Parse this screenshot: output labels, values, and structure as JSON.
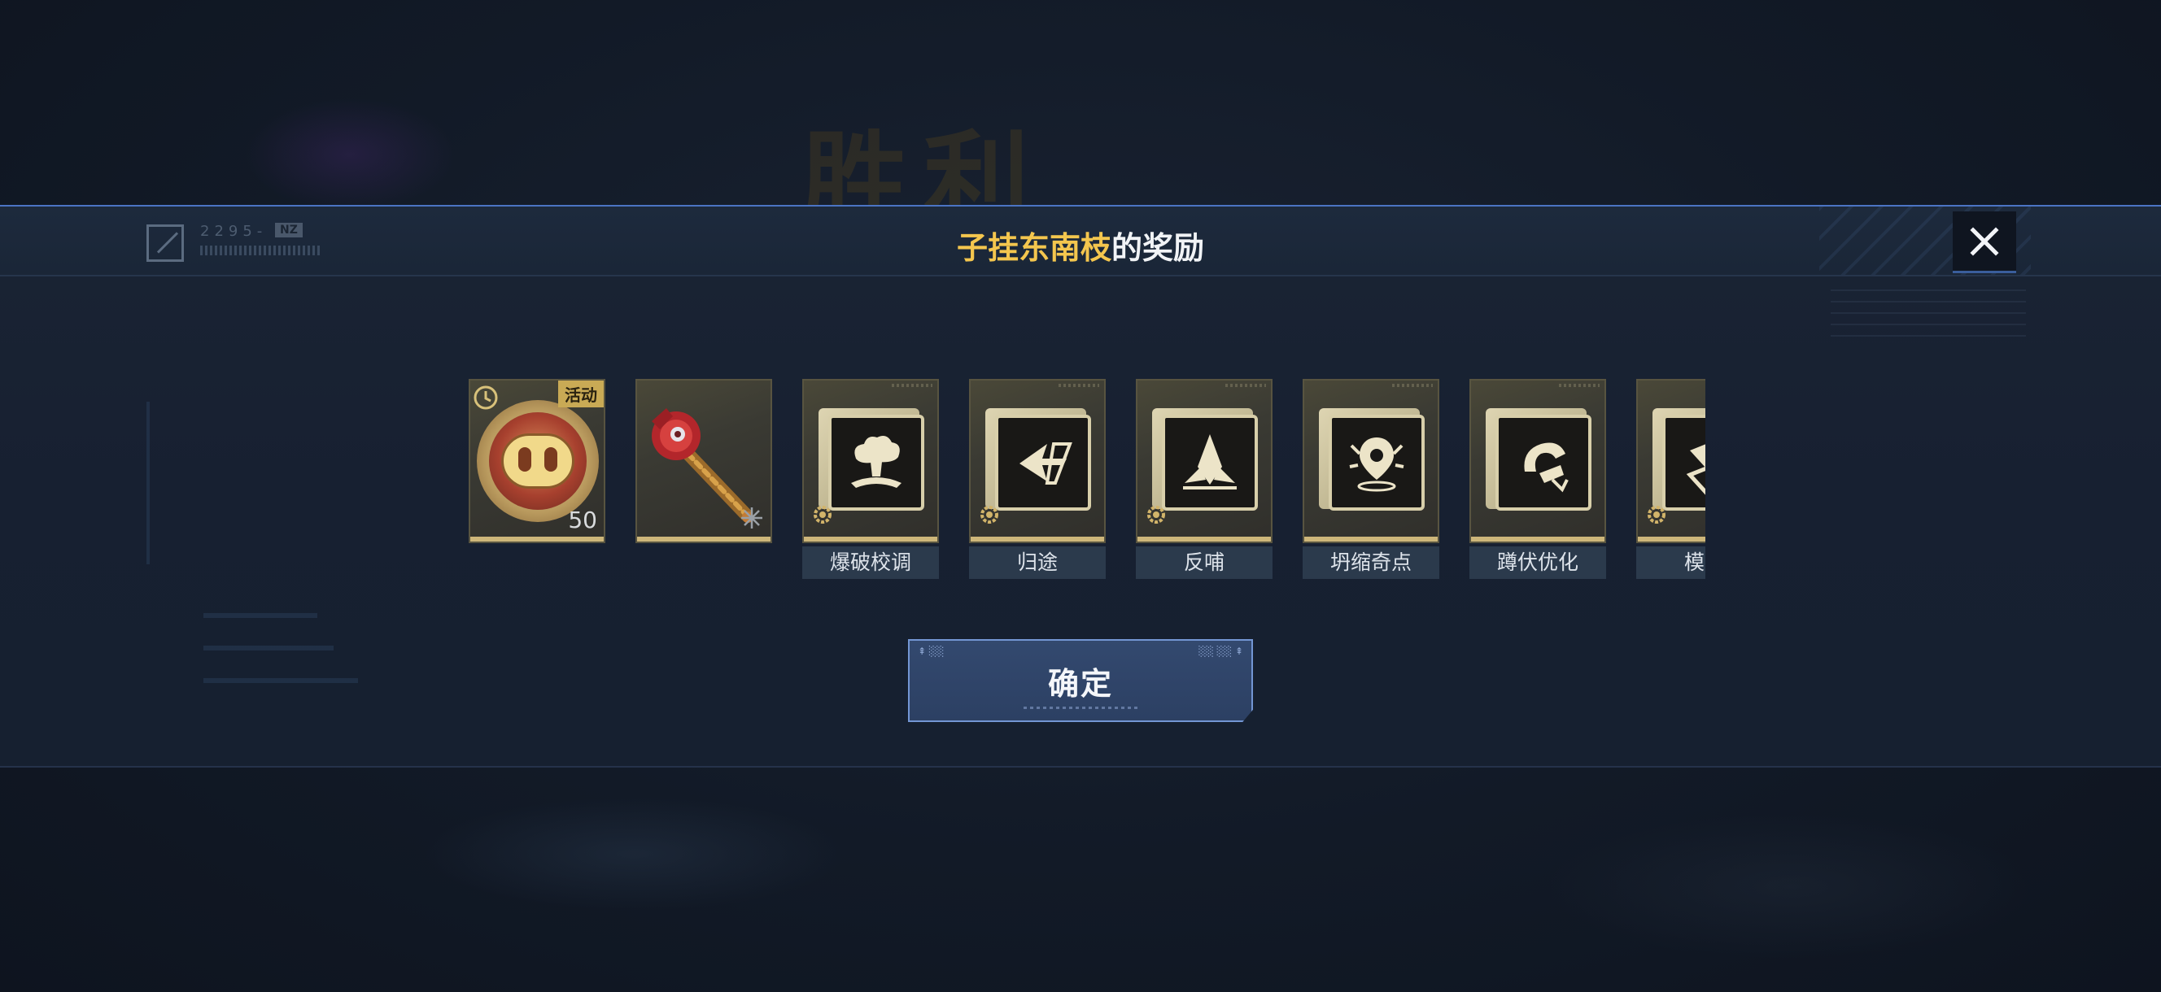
{
  "background": {
    "victory_text": "胜利"
  },
  "header": {
    "logo_code": "2295-",
    "logo_tag": "NZ",
    "player_name": "子挂东南枝",
    "title_suffix": "的奖励",
    "close_icon": "close-icon"
  },
  "rewards": [
    {
      "id": "activity-coin",
      "badge": "活动",
      "count": "50",
      "label": "",
      "icon": "pig-coin-icon",
      "timed_icon": "clock-icon"
    },
    {
      "id": "weapon-skin",
      "badge": "",
      "count": "",
      "label": "",
      "icon": "ornate-wrench-icon",
      "extra_icon": "spark-icon"
    },
    {
      "id": "chip-1",
      "label": "爆破校调",
      "icon": "explosion-chip-icon"
    },
    {
      "id": "chip-2",
      "label": "归途",
      "icon": "return-path-chip-icon"
    },
    {
      "id": "chip-3",
      "label": "反哺",
      "icon": "crystal-chip-icon"
    },
    {
      "id": "chip-4",
      "label": "坍缩奇点",
      "icon": "singularity-chip-icon"
    },
    {
      "id": "chip-5",
      "label": "蹲伏优化",
      "icon": "crouch-chip-icon"
    },
    {
      "id": "chip-6",
      "label": "模式",
      "icon": "mode-chip-icon"
    }
  ],
  "confirm": {
    "label": "确定"
  },
  "colors": {
    "accent_blue": "#4b74c4",
    "player_name_gold": "#f4c64e",
    "card_gold": "#cdb67a",
    "badge_gold": "#c9aa55"
  }
}
